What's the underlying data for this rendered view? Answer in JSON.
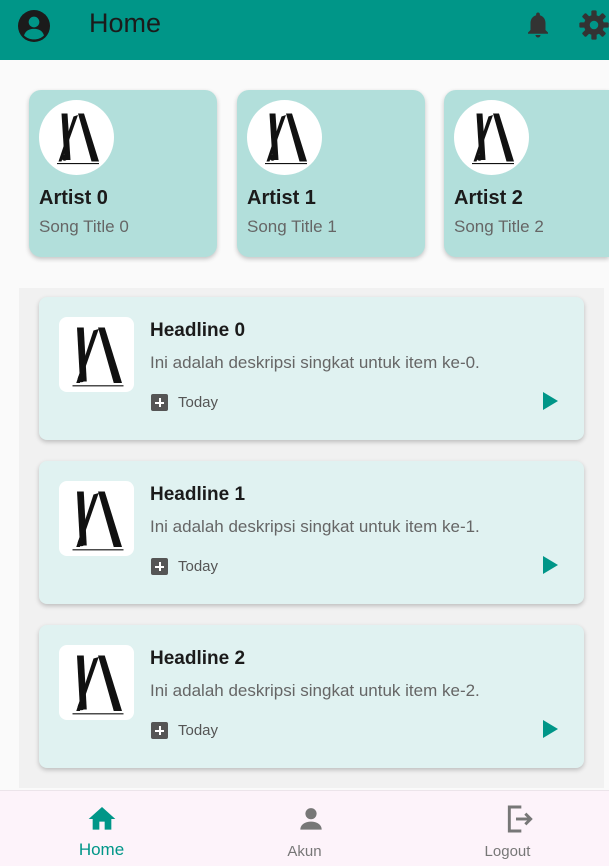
{
  "appbar": {
    "title": "Home",
    "background": "#009688",
    "icons": [
      "account-circle-icon",
      "notifications-icon",
      "settings-icon"
    ]
  },
  "artists": [
    {
      "name": "Artist 0",
      "song": "Song Title 0"
    },
    {
      "name": "Artist 1",
      "song": "Song Title 1"
    },
    {
      "name": "Artist 2",
      "song": "Song Title 2"
    }
  ],
  "news": [
    {
      "headline": "Headline 0",
      "description": "Ini adalah deskripsi singkat untuk item ke-0.",
      "date": "Today"
    },
    {
      "headline": "Headline 1",
      "description": "Ini adalah deskripsi singkat untuk item ke-1.",
      "date": "Today"
    },
    {
      "headline": "Headline 2",
      "description": "Ini adalah deskripsi singkat untuk item ke-2.",
      "date": "Today"
    }
  ],
  "bottom_nav": {
    "items": [
      {
        "label": "Home",
        "icon": "home-icon",
        "active": true
      },
      {
        "label": "Akun",
        "icon": "person-icon",
        "active": false
      },
      {
        "label": "Logout",
        "icon": "logout-icon",
        "active": false
      }
    ],
    "active_color": "#009688"
  },
  "colors": {
    "artist_card": "#b2dfdb",
    "news_card": "#e0f2f1",
    "play_icon": "#009688"
  }
}
